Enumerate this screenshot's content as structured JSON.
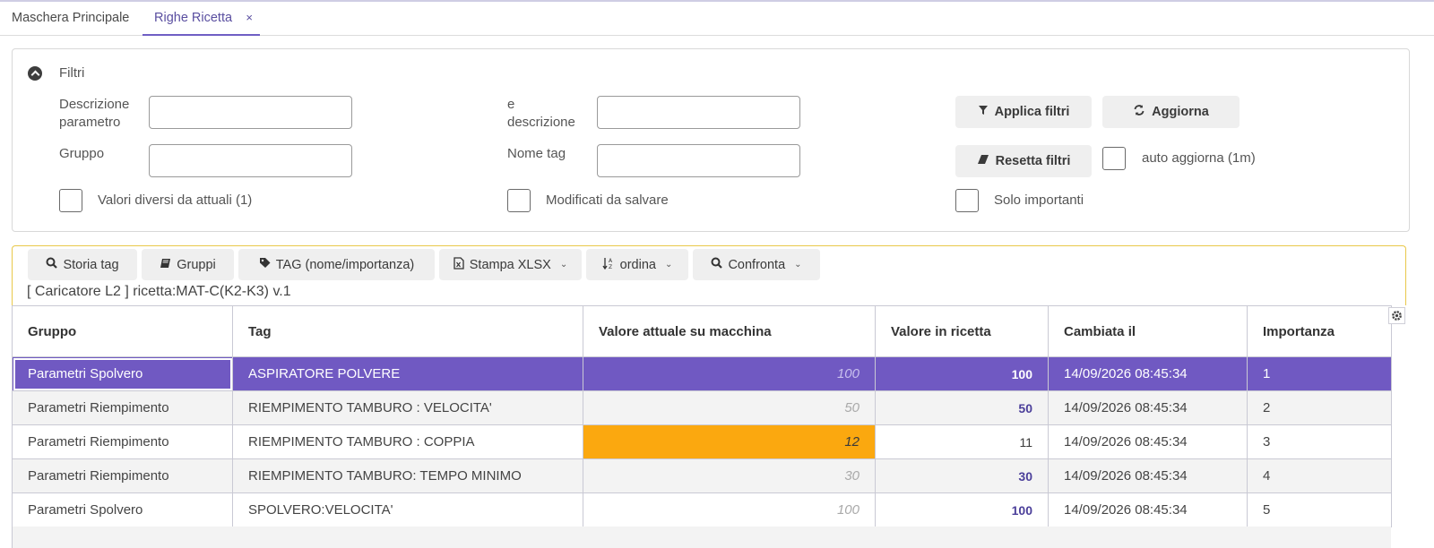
{
  "tabs": [
    {
      "label": "Maschera Principale"
    },
    {
      "label": "Righe Ricetta",
      "close": "×"
    }
  ],
  "filters": {
    "title": "Filtri",
    "descrizione_label_1": "Descrizione",
    "descrizione_label_2": "parametro",
    "e_label_1": "e",
    "e_label_2": "descrizione",
    "gruppo_label": "Gruppo",
    "nome_tag_label": "Nome tag",
    "descrizione_value": "",
    "e_descrizione_value": "",
    "gruppo_value": "",
    "nome_tag_value": "",
    "chk_valori_diversi": "Valori diversi da attuali (1)",
    "chk_modificati": "Modificati da salvare",
    "chk_solo_importanti": "Solo importanti",
    "chk_auto_aggiorna": "auto aggiorna (1m)",
    "btn_applica": "Applica filtri",
    "btn_aggiorna": "Aggiorna",
    "btn_resetta": "Resetta filtri"
  },
  "toolbar": {
    "storia_tag": "Storia tag",
    "gruppi": "Gruppi",
    "tag_nome": "TAG (nome/importanza)",
    "stampa": "Stampa XLSX",
    "ordina": "ordina",
    "confronta": "Confronta",
    "caption": "[ Caricatore L2 ] ricetta:MAT-C(K2-K3) v.1"
  },
  "table": {
    "headers": [
      "Gruppo",
      "Tag",
      "Valore attuale su macchina",
      "Valore in ricetta",
      "Cambiata il",
      "Importanza"
    ],
    "rows": [
      {
        "gruppo": "Parametri Spolvero",
        "tag": "ASPIRATORE POLVERE",
        "attuale": "100",
        "ricetta": "100",
        "cambiata": "14/09/2026 08:45:34",
        "importanza": "1"
      },
      {
        "gruppo": "Parametri Riempimento",
        "tag": "RIEMPIMENTO TAMBURO : VELOCITA'",
        "attuale": "50",
        "ricetta": "50",
        "cambiata": "14/09/2026 08:45:34",
        "importanza": "2"
      },
      {
        "gruppo": "Parametri Riempimento",
        "tag": "RIEMPIMENTO TAMBURO : COPPIA",
        "attuale": "12",
        "ricetta": "11",
        "cambiata": "14/09/2026 08:45:34",
        "importanza": "3"
      },
      {
        "gruppo": "Parametri Riempimento",
        "tag": "RIEMPIMENTO TAMBURO: TEMPO MINIMO",
        "attuale": "30",
        "ricetta": "30",
        "cambiata": "14/09/2026 08:45:34",
        "importanza": "4"
      },
      {
        "gruppo": "Parametri Spolvero",
        "tag": "SPOLVERO:VELOCITA'",
        "attuale": "100",
        "ricetta": "100",
        "cambiata": "14/09/2026 08:45:34",
        "importanza": "5"
      }
    ]
  },
  "colors": {
    "accent": "#7059c2",
    "highlight_diff": "#fba80f",
    "toolbar_border": "#e9c84a"
  }
}
